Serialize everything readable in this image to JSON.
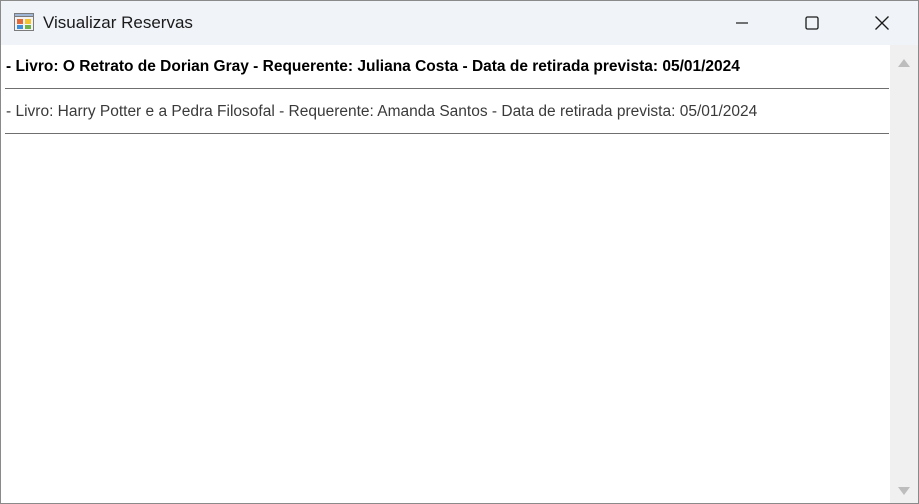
{
  "window": {
    "title": "Visualizar Reservas"
  },
  "icons": {
    "app": "app-form-icon",
    "minimize": "minimize-icon",
    "maximize": "maximize-icon",
    "close": "close-icon",
    "scroll_up": "scroll-up-arrow-icon",
    "scroll_down": "scroll-down-arrow-icon"
  },
  "reservas": [
    {
      "text": "- Livro: O Retrato de Dorian Gray - Requerente: Juliana Costa - Data de retirada prevista: 05/01/2024",
      "selected": true
    },
    {
      "text": "- Livro: Harry Potter e a Pedra Filosofal - Requerente: Amanda Santos - Data de retirada prevista: 05/01/2024",
      "selected": false
    }
  ],
  "colors": {
    "titlebar": "#f0f4f9",
    "scrollbar": "#f0f0f0",
    "divider": "#6f6f6f"
  }
}
